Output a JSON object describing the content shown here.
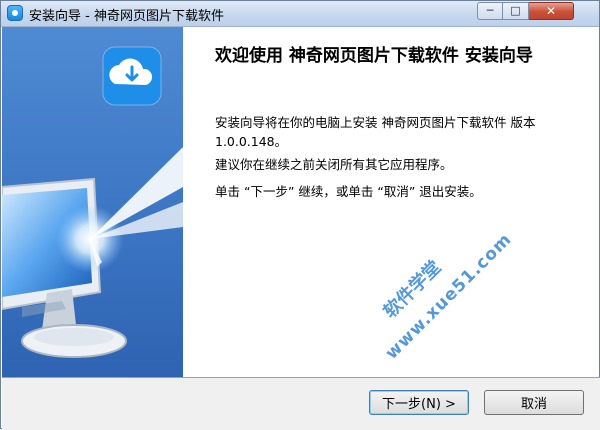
{
  "window": {
    "title": "安装向导 - 神奇网页图片下载软件"
  },
  "title_buttons": {
    "minimize_glyph": "─",
    "maximize_glyph": "□",
    "close_glyph": "✕"
  },
  "main": {
    "heading": "欢迎使用 神奇网页图片下载软件 安装向导",
    "install_text": "安装向导将在你的电脑上安装 神奇网页图片下载软件 版本 1.0.0.148。",
    "close_apps_text": "建议你在继续之前关闭所有其它应用程序。",
    "instruction_text": "单击 “下一步” 继续，或单击 “取消” 退出安装。"
  },
  "watermark": {
    "line1": "软件学堂",
    "line2": "www.xue51.com"
  },
  "buttons": {
    "next_label": "下一步(N) >",
    "cancel_label": "取消"
  },
  "colors": {
    "sidebar_blue": "#3b79c8",
    "watermark_blue": "#2a7fd4",
    "icon_blue": "#1e8ee8"
  },
  "icons": {
    "app_icon": "cloud-download-app-icon",
    "sidebar_cloud": "cloud-download-icon",
    "sidebar_monitor": "monitor-arrow-illustration"
  }
}
